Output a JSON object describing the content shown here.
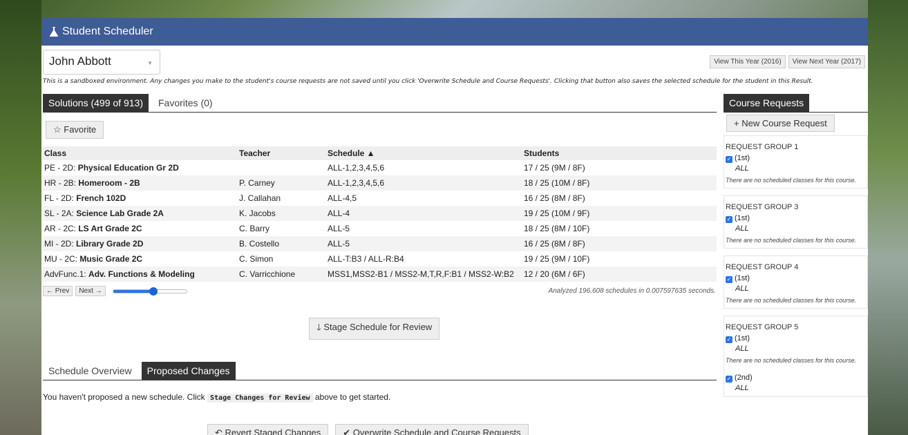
{
  "app": {
    "title": "Student Scheduler"
  },
  "student": {
    "name": "John Abbott"
  },
  "years": {
    "this": "View This Year (2016)",
    "next": "View Next Year (2017)"
  },
  "notice": "This is a sandboxed environment. Any changes you make to the student's course requests are not saved until you click 'Overwrite Schedule and Course Requests'. Clicking that button also saves the selected schedule for the student in this Result.",
  "solutions_tabs": {
    "solutions": "Solutions (499 of 913)",
    "favorites": "Favorites (0)"
  },
  "favorite_button": "☆ Favorite",
  "table": {
    "headers": [
      "Class",
      "Teacher",
      "Schedule ▲",
      "Students"
    ],
    "rows": [
      {
        "code": "PE - 2D: ",
        "name": "Physical Education Gr 2D",
        "teacher": "",
        "schedule": "ALL-1,2,3,4,5,6",
        "students": "17 / 25 (9M / 8F)"
      },
      {
        "code": "HR - 2B: ",
        "name": "Homeroom - 2B",
        "teacher": "P. Carney",
        "schedule": "ALL-1,2,3,4,5,6",
        "students": "18 / 25 (10M / 8F)"
      },
      {
        "code": "FL - 2D: ",
        "name": "French 102D",
        "teacher": "J. Callahan",
        "schedule": "ALL-4,5",
        "students": "16 / 25 (8M / 8F)"
      },
      {
        "code": "SL - 2A: ",
        "name": "Science Lab Grade 2A",
        "teacher": "K. Jacobs",
        "schedule": "ALL-4",
        "students": "19 / 25 (10M / 9F)"
      },
      {
        "code": "AR - 2C: ",
        "name": "LS Art Grade 2C",
        "teacher": "C. Barry",
        "schedule": "ALL-5",
        "students": "18 / 25 (8M / 10F)"
      },
      {
        "code": "MI - 2D: ",
        "name": "Library Grade 2D",
        "teacher": "B. Costello",
        "schedule": "ALL-5",
        "students": "16 / 25 (8M / 8F)"
      },
      {
        "code": "MU - 2C: ",
        "name": "Music Grade 2C",
        "teacher": "C. Simon",
        "schedule": "ALL-T:B3 / ALL-R:B4",
        "students": "19 / 25 (9M / 10F)"
      },
      {
        "code": "AdvFunc.1: ",
        "name": "Adv. Functions & Modeling",
        "teacher": "C. Varricchione",
        "schedule": "MSS1,MSS2-B1 / MSS2-M,T,R,F:B1 / MSS2-W:B2",
        "students": "12 / 20 (6M / 6F)"
      }
    ]
  },
  "pager": {
    "prev": "← Prev",
    "next": "Next →",
    "slider_fraction": 0.55
  },
  "analyzed": "Analyzed 196,608 schedules in 0.007597635 seconds.",
  "stage_button": "Stage Schedule for Review",
  "overview_tabs": {
    "overview": "Schedule Overview",
    "proposed": "Proposed Changes"
  },
  "no_schedule": {
    "before": "You haven't proposed a new schedule. Click ",
    "code": "Stage Changes for Review",
    "after": " above to get started."
  },
  "bottom_buttons": {
    "revert": "Revert Staged Changes",
    "overwrite": "Overwrite Schedule and Course Requests"
  },
  "course_requests": {
    "tab": "Course Requests",
    "new_button": "+ New Course Request",
    "groups": [
      {
        "title": "REQUEST GROUP 1",
        "choice": "(1st)",
        "all": "ALL",
        "none": "There are no scheduled classes for this course."
      },
      {
        "title": "REQUEST GROUP 3",
        "choice": "(1st)",
        "all": "ALL",
        "none": "There are no scheduled classes for this course."
      },
      {
        "title": "REQUEST GROUP 4",
        "choice": "(1st)",
        "all": "ALL",
        "none": "There are no scheduled classes for this course."
      },
      {
        "title": "REQUEST GROUP 5",
        "choice": "(1st)",
        "all": "ALL",
        "none": "There are no scheduled classes for this course.",
        "choice2": "(2nd)",
        "all2": "ALL"
      }
    ]
  },
  "colors": {
    "titlebar": "#3e5c96",
    "active_tab": "#333333",
    "accent": "#2b73e6"
  }
}
